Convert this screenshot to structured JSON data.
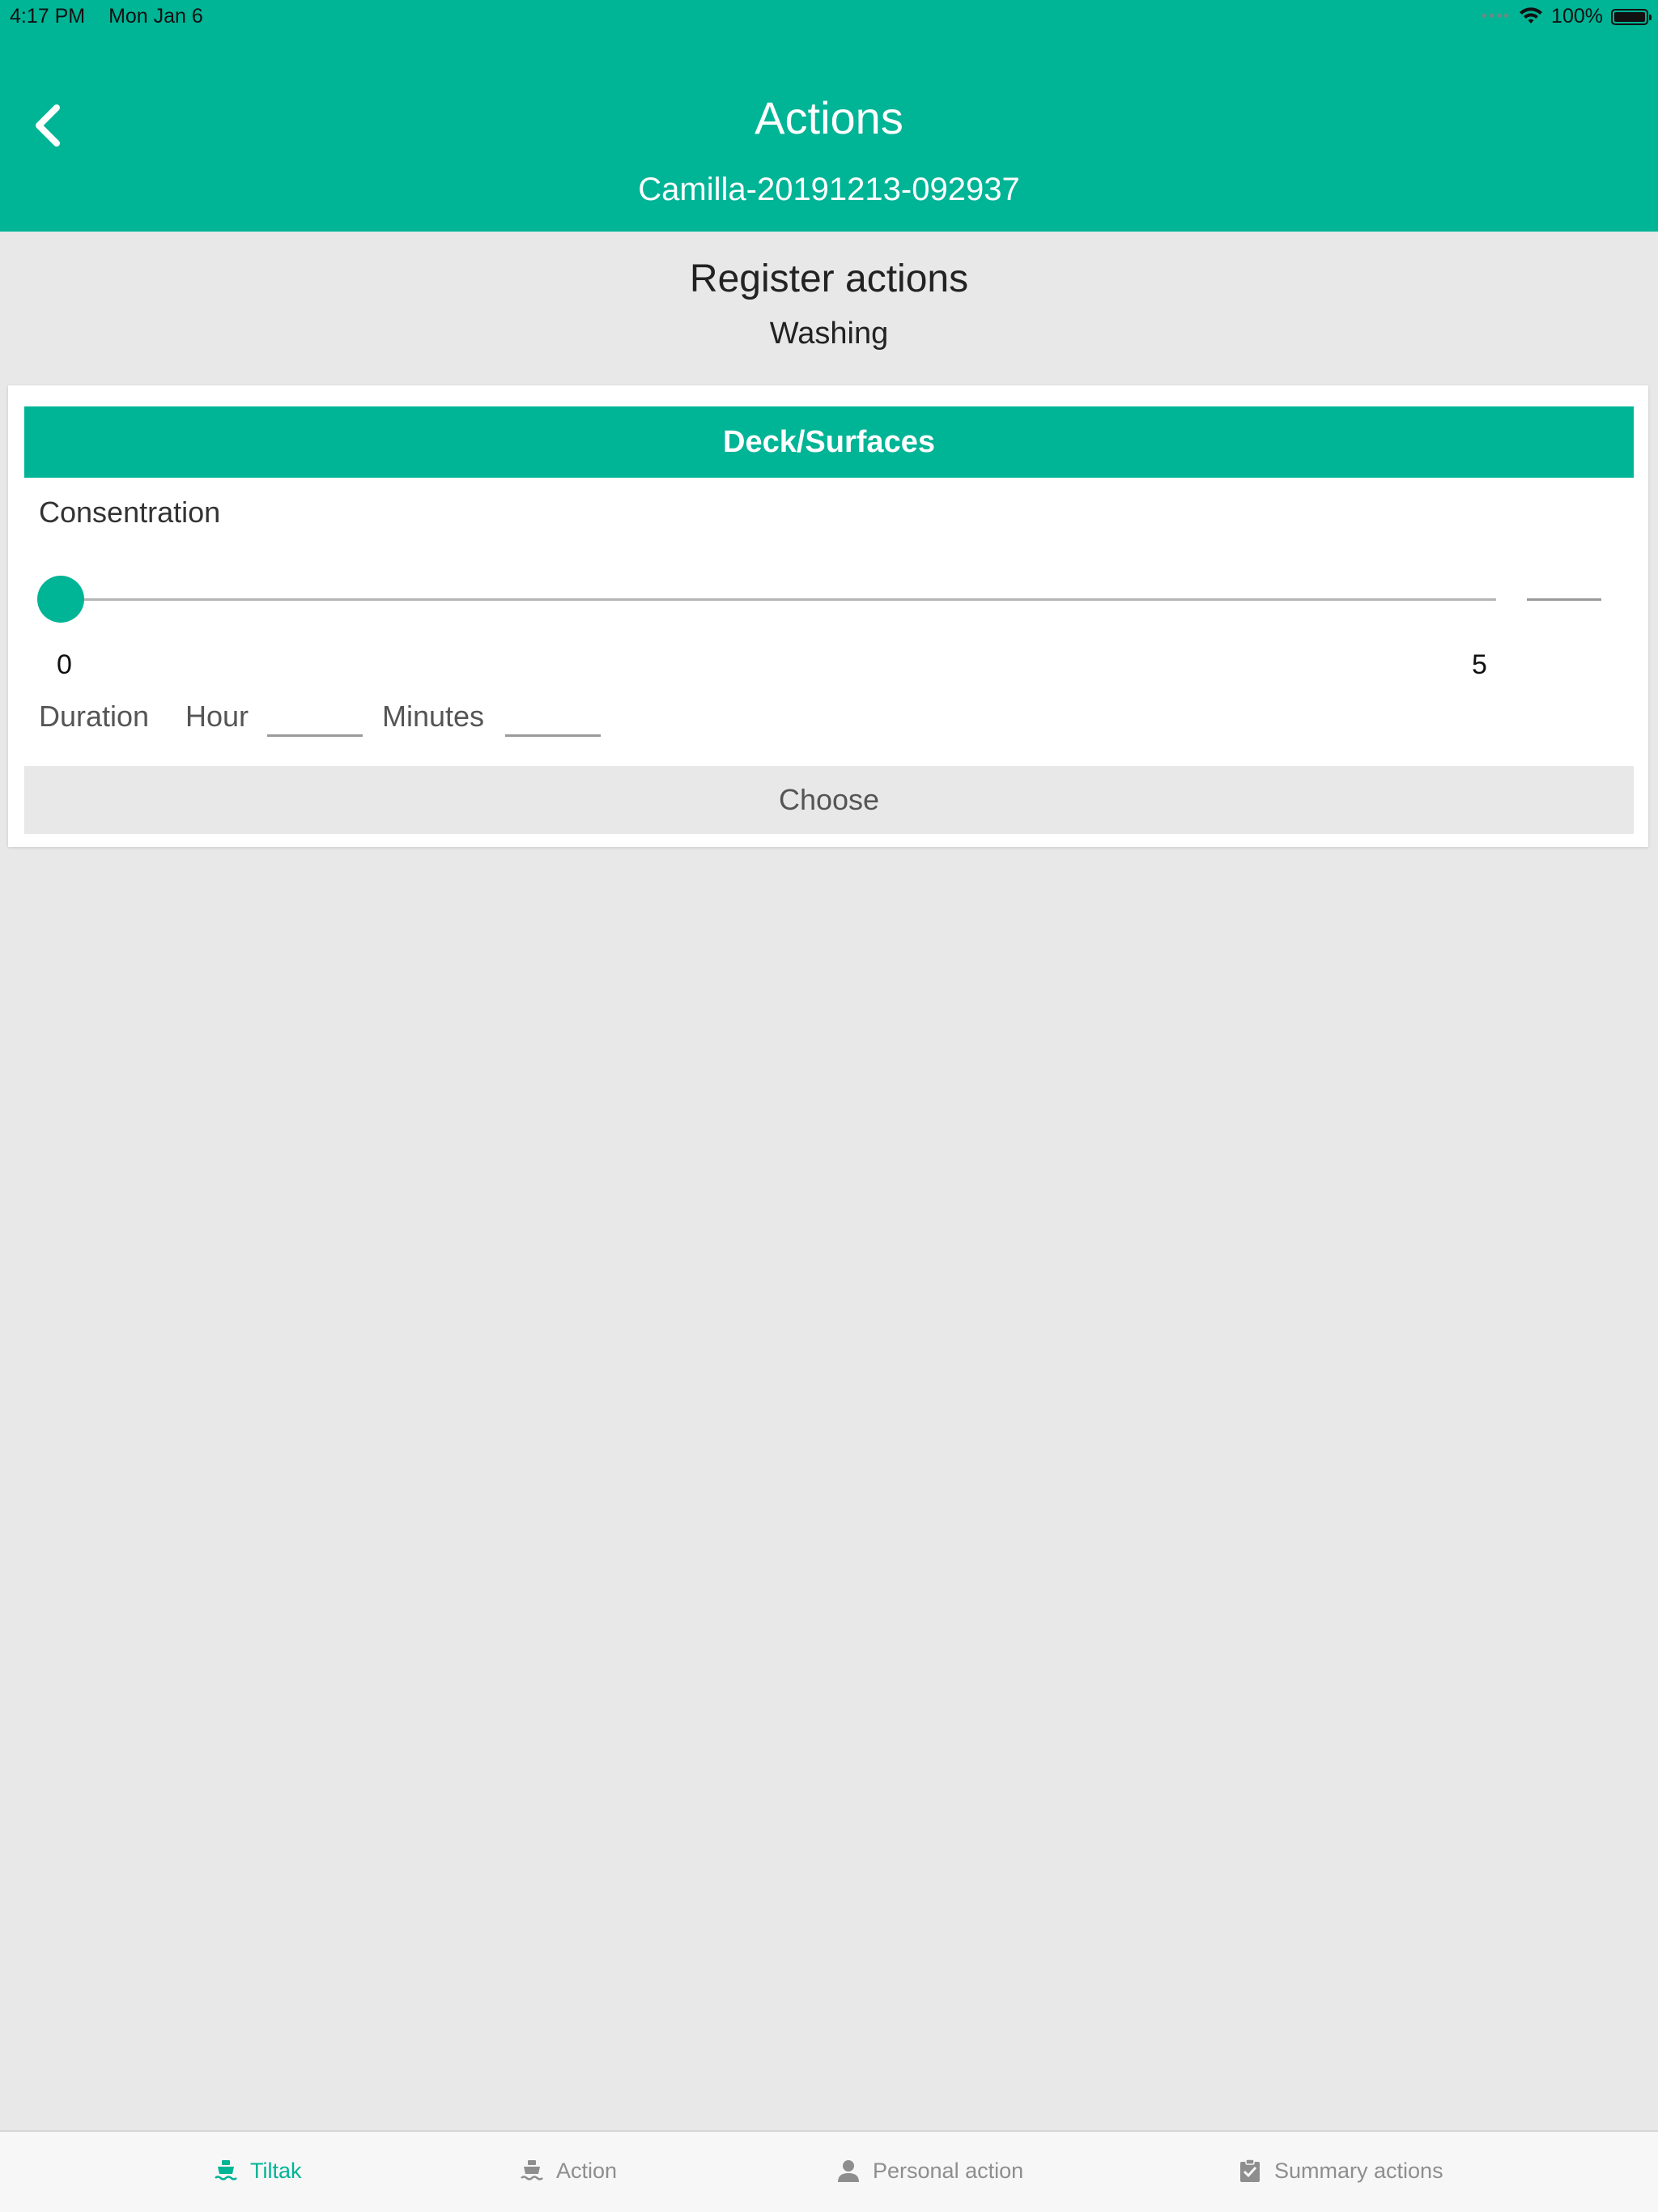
{
  "status_bar": {
    "time": "4:17 PM",
    "date": "Mon Jan 6",
    "battery": "100%"
  },
  "header": {
    "title": "Actions",
    "subtitle": "Camilla-20191213-092937"
  },
  "section": {
    "title": "Register actions",
    "subtitle": "Washing"
  },
  "card": {
    "heading": "Deck/Surfaces",
    "slider": {
      "label": "Consentration",
      "min": "0",
      "max": "5",
      "value": 0
    },
    "duration": {
      "label": "Duration",
      "hour_label": "Hour",
      "minutes_label": "Minutes",
      "hour_value": "",
      "minutes_value": ""
    },
    "choose_label": "Choose"
  },
  "tabs": [
    {
      "label": "Tiltak",
      "icon": "ship-icon",
      "active": true
    },
    {
      "label": "Action",
      "icon": "ship-icon",
      "active": false
    },
    {
      "label": "Personal action",
      "icon": "person-icon",
      "active": false
    },
    {
      "label": "Summary actions",
      "icon": "clipboard-check-icon",
      "active": false
    }
  ],
  "colors": {
    "accent": "#00b496",
    "background": "#e8e8e8",
    "card": "#ffffff"
  }
}
